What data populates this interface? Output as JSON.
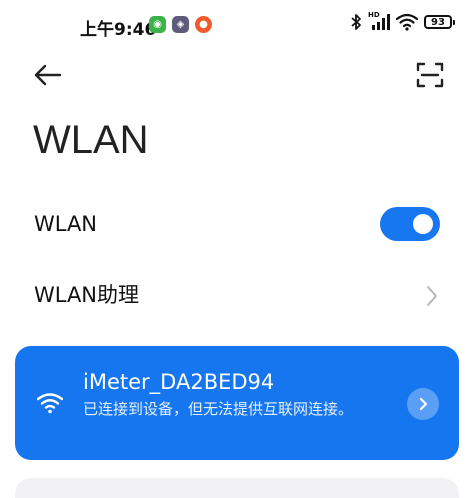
{
  "status_bar": {
    "time": "上午9:46",
    "battery": "93",
    "network_badge": "HD"
  },
  "header": {
    "title": "WLAN"
  },
  "settings": {
    "wlan_toggle": {
      "label": "WLAN",
      "state": "on"
    },
    "wlan_assistant": {
      "label": "WLAN助理"
    }
  },
  "connected_network": {
    "ssid": "iMeter_DA2BED94",
    "status": "已连接到设备，但无法提供互联网连接。"
  },
  "colors": {
    "accent": "#1777f1",
    "card": "#1676ef"
  }
}
